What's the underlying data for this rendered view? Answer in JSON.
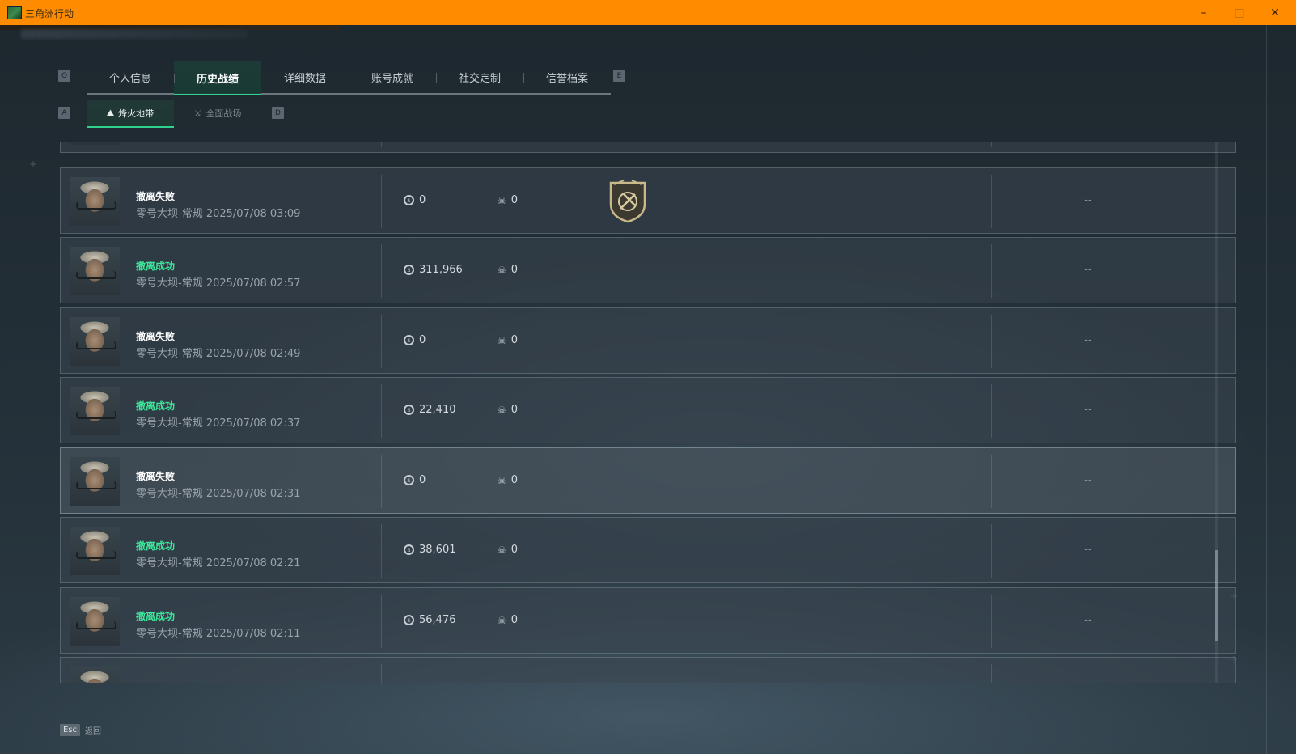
{
  "titlebar": {
    "title": "三角洲行动",
    "min": "–",
    "max": "□",
    "close": "✕"
  },
  "tabs": {
    "prev_key": "Q",
    "next_key": "E",
    "items": [
      {
        "label": "个人信息"
      },
      {
        "label": "历史战绩"
      },
      {
        "label": "详细数据"
      },
      {
        "label": "账号成就"
      },
      {
        "label": "社交定制"
      },
      {
        "label": "信誉档案"
      }
    ],
    "active_index": 1
  },
  "subtabs": {
    "prev_key": "A",
    "next_key": "D",
    "items": [
      {
        "label": "烽火地带",
        "icon": "extraction-icon"
      },
      {
        "label": "全面战场",
        "icon": "battlefield-icon"
      }
    ],
    "active_index": 0
  },
  "records": [
    {
      "status": "撤离失败",
      "result": "fail",
      "map": "零号大坝-常规",
      "time": "2025/07/08 03:09",
      "money": "0",
      "kills": "0",
      "extra": "--",
      "badge": true
    },
    {
      "status": "撤离成功",
      "result": "success",
      "map": "零号大坝-常规",
      "time": "2025/07/08 02:57",
      "money": "311,966",
      "kills": "0",
      "extra": "--",
      "badge": false
    },
    {
      "status": "撤离失败",
      "result": "fail",
      "map": "零号大坝-常规",
      "time": "2025/07/08 02:49",
      "money": "0",
      "kills": "0",
      "extra": "--",
      "badge": false
    },
    {
      "status": "撤离成功",
      "result": "success",
      "map": "零号大坝-常规",
      "time": "2025/07/08 02:37",
      "money": "22,410",
      "kills": "0",
      "extra": "--",
      "badge": false
    },
    {
      "status": "撤离失败",
      "result": "fail",
      "map": "零号大坝-常规",
      "time": "2025/07/08 02:31",
      "money": "0",
      "kills": "0",
      "extra": "--",
      "badge": false
    },
    {
      "status": "撤离成功",
      "result": "success",
      "map": "零号大坝-常规",
      "time": "2025/07/08 02:21",
      "money": "38,601",
      "kills": "0",
      "extra": "--",
      "badge": false
    },
    {
      "status": "撤离成功",
      "result": "success",
      "map": "零号大坝-常规",
      "time": "2025/07/08 02:11",
      "money": "56,476",
      "kills": "0",
      "extra": "--",
      "badge": false
    }
  ],
  "footer": {
    "esc_key": "Esc",
    "back_label": "返回"
  },
  "colors": {
    "titlebar": "#ff8c00",
    "accent": "#2fd28c",
    "success_text": "#3ee59a"
  }
}
